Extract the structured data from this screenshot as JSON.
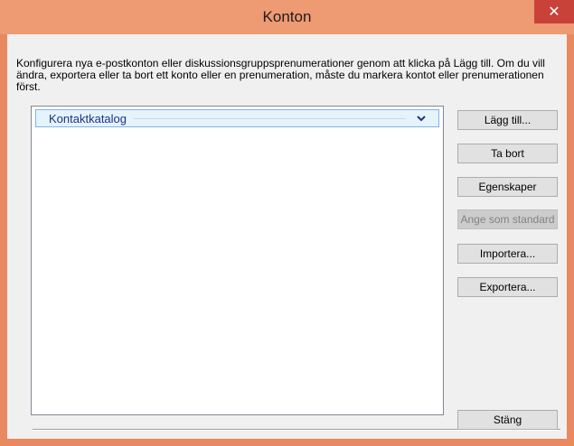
{
  "window": {
    "title": "Konton",
    "close_glyph": "✕"
  },
  "description": "Konfigurera nya e-postkonton eller diskussionsgruppsprenumerationer genom att klicka på Lägg till. Om du vill ändra, exportera eller ta bort ett konto eller en prenumeration, måste du markera kontot eller prenumerationen först.",
  "accounts_list": {
    "groups": [
      {
        "label": "Kontaktkatalog",
        "icon": "chevron-down-icon"
      }
    ]
  },
  "buttons": {
    "add": "Lägg till...",
    "remove": "Ta bort",
    "properties": "Egenskaper",
    "set_default": "Ange som standard",
    "import": "Importera...",
    "export": "Exportera...",
    "close": "Stäng"
  },
  "colors": {
    "titlebar": "#ee9a72",
    "close_button": "#c9423a",
    "group_header_border": "#7eb4ea",
    "group_header_text": "#1e3287"
  }
}
